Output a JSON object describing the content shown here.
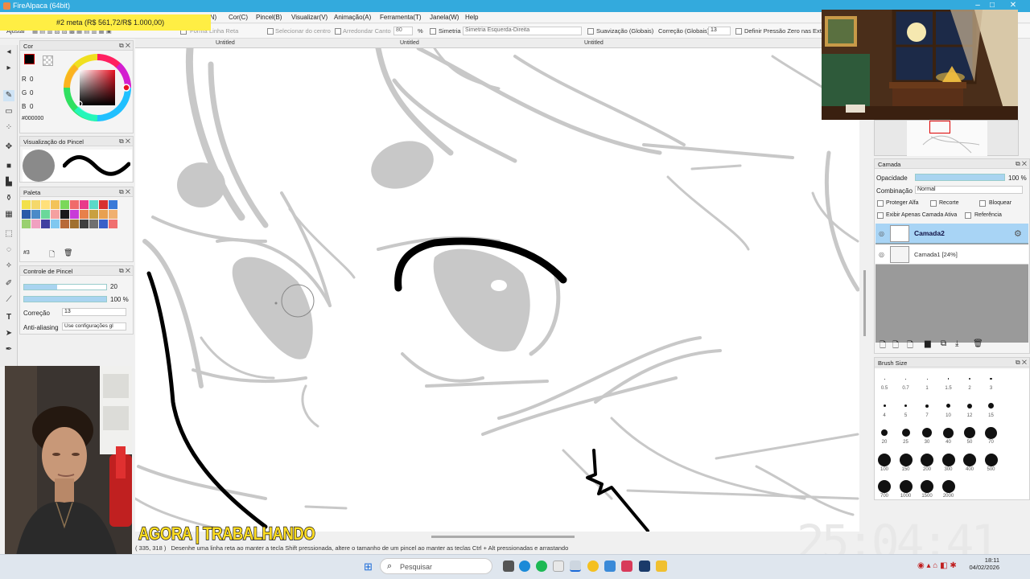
{
  "app": {
    "title": "FireAlpaca (64bit)"
  },
  "goal_banner": "#2 meta (R$ 561,72/R$ 1.000,00)",
  "menu": [
    "(N)",
    "Cor(C)",
    "Pincel(B)",
    "Visualizar(V)",
    "Animação(A)",
    "Ferramenta(T)",
    "Janela(W)",
    "Help"
  ],
  "toolbar": {
    "ajustar": "Ajustar",
    "forma": "Forma",
    "linha_reta": "Linha Reta",
    "selecionar_centro": "Selecionar do centro",
    "arredondar_canto": "Arredondar Canto",
    "arredondar_val": "80",
    "percent": "%",
    "simetria": "Simetria",
    "simetria_mode": "Simetria Esquerda-Direita",
    "suavizacao": "Suavização (Globais)",
    "correcao": "Correção (Globais)",
    "correcao_val": "13",
    "pressao": "Definir Pressão Zero nas Extre"
  },
  "doc_tabs": [
    "Untitled",
    "Untitled",
    "Untitled"
  ],
  "color_panel": {
    "title": "Cor",
    "r_label": "R",
    "g_label": "G",
    "b_label": "B",
    "r": "0",
    "g": "0",
    "b": "0",
    "hex": "#000000"
  },
  "brush_preview": {
    "title": "Visualização do Pincel"
  },
  "palette": {
    "title": "Paleta",
    "name": "#3",
    "colors": [
      "#f2e04a",
      "#f5d86a",
      "#ffe07a",
      "#f3c35a",
      "#7ad85a",
      "#f06a6a",
      "#e83a8a",
      "#5ad8c8",
      "#d83030",
      "#3a7ad8",
      "#2a5aa8",
      "#4a8ac8",
      "#6ad89a",
      "#f5a0a0",
      "#1a1a1a",
      "#c83ad8",
      "#e8804a",
      "#c8a040",
      "#e8a050",
      "#f0b070",
      "#9ad070",
      "#f0a0c0",
      "#4040a0",
      "#80c8f0",
      "#b86a3a",
      "#a07030",
      "#404040",
      "#707070",
      "#3a60c8",
      "#f07070"
    ]
  },
  "brush_control": {
    "title": "Controle de Pincel",
    "size": "20",
    "opacity": "100 %",
    "size_fraction": 0.4,
    "opacity_fraction": 1.0,
    "correcao_label": "Correção",
    "correcao_val": "13",
    "antialias_label": "Anti-aliasing",
    "antialias_val": "Use configurações gl"
  },
  "layer_panel": {
    "title": "Camada",
    "opacidade_label": "Opacidade",
    "opacidade_val": "100 %",
    "combinacao_label": "Combinação",
    "combinacao_val": "Normal",
    "proteger_alfa": "Proteger Alfa",
    "recorte": "Recorte",
    "bloquear": "Bloquear",
    "exibir_ativa": "Exibir Apenas Camada Ativa",
    "referencia": "Referência",
    "layers": [
      {
        "name": "Camada2",
        "active": true
      },
      {
        "name": "Camada1 [24%]",
        "active": false
      }
    ]
  },
  "brush_size": {
    "title": "Brush Size",
    "sizes": [
      "0.5",
      "0.7",
      "1",
      "1.5",
      "2",
      "3",
      "4",
      "5",
      "7",
      "10",
      "12",
      "15",
      "20",
      "25",
      "30",
      "40",
      "50",
      "70",
      "100",
      "150",
      "200",
      "300",
      "400",
      "500",
      "700",
      "1000",
      "1500",
      "2000"
    ]
  },
  "status": {
    "coords": "( 335, 318 )",
    "hint": "Desenhe uma linha reta ao manter a tecla Shift pressionada, altere o tamanho de um pincel ao manter as teclas Ctrl + Alt pressionadas e arrastando"
  },
  "overlay_banner": "AGORA | TRABALHANDO",
  "clock": "25:04:41",
  "taskbar": {
    "search_placeholder": "Pesquisar",
    "time": "18:11",
    "date": "04/02/2026"
  }
}
